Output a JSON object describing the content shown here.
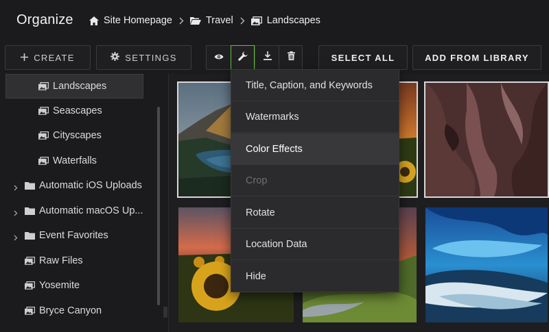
{
  "header": {
    "title": "Organize",
    "breadcrumb": [
      {
        "label": "Site Homepage",
        "icon": "home-icon"
      },
      {
        "label": "Travel",
        "icon": "folder-open-icon"
      },
      {
        "label": "Landscapes",
        "icon": "gallery-icon"
      }
    ]
  },
  "toolbar": {
    "create_label": "CREATE",
    "settings_label": "SETTINGS",
    "icon_buttons": [
      "eye-icon",
      "wrench-icon",
      "download-icon",
      "trash-icon"
    ],
    "active_icon": "wrench-icon",
    "select_all_label": "SELECT ALL",
    "add_from_library_label": "ADD FROM LIBRARY",
    "accent_color": "#62c437"
  },
  "sidebar": {
    "items": [
      {
        "label": "Landscapes",
        "type": "gallery",
        "selected": true
      },
      {
        "label": "Seascapes",
        "type": "gallery"
      },
      {
        "label": "Cityscapes",
        "type": "gallery"
      },
      {
        "label": "Waterfalls",
        "type": "gallery"
      },
      {
        "label": "Automatic iOS Uploads",
        "type": "folder",
        "expandable": true
      },
      {
        "label": "Automatic macOS Up...",
        "type": "folder",
        "expandable": true
      },
      {
        "label": "Event Favorites",
        "type": "folder",
        "expandable": true
      },
      {
        "label": "Raw Files",
        "type": "gallery"
      },
      {
        "label": "Yosemite",
        "type": "gallery"
      },
      {
        "label": "Bryce Canyon",
        "type": "gallery"
      }
    ]
  },
  "menu": {
    "items": [
      {
        "label": "Title, Caption, and Keywords"
      },
      {
        "label": "Watermarks"
      },
      {
        "label": "Color Effects",
        "state": "hover"
      },
      {
        "label": "Crop",
        "state": "disabled"
      },
      {
        "label": "Rotate"
      },
      {
        "label": "Location Data"
      },
      {
        "label": "Hide"
      }
    ]
  },
  "photos": [
    {
      "subject": "mountain-lake",
      "selected": true
    },
    {
      "subject": "sunset-field",
      "selected": true
    },
    {
      "subject": "slot-canyon",
      "selected": true
    },
    {
      "subject": "sunflower-sunset",
      "selected": false
    },
    {
      "subject": "green-valley-stream",
      "selected": false
    },
    {
      "subject": "ice-cave-river",
      "selected": false
    }
  ]
}
